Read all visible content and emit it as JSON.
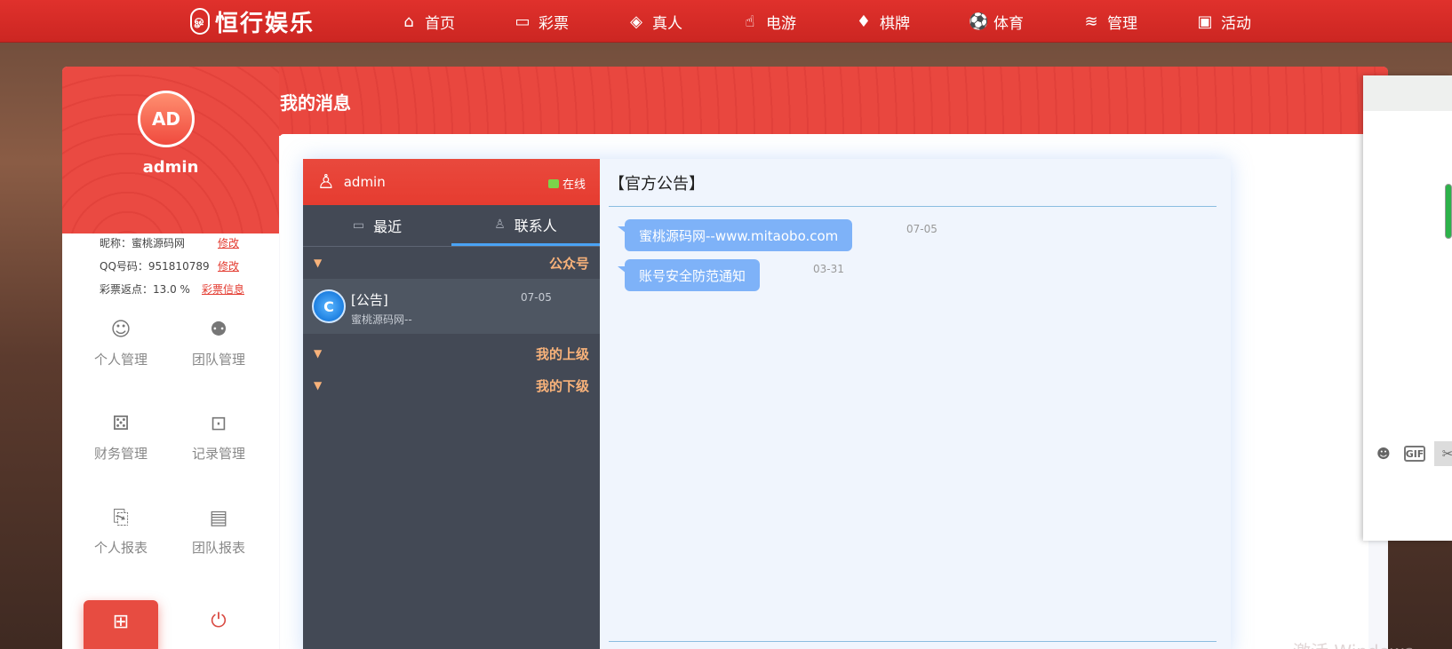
{
  "topnav": {
    "logo_text": "恒行娱乐",
    "logo_mark": "ம",
    "items": [
      {
        "label": "首页",
        "icon": "home-icon"
      },
      {
        "label": "彩票",
        "icon": "ticket-icon"
      },
      {
        "label": "真人",
        "icon": "casino-icon"
      },
      {
        "label": "电游",
        "icon": "thumb-icon"
      },
      {
        "label": "棋牌",
        "icon": "cards-icon"
      },
      {
        "label": "体育",
        "icon": "ball-icon"
      },
      {
        "label": "管理",
        "icon": "layers-icon"
      },
      {
        "label": "活动",
        "icon": "gift-icon"
      }
    ]
  },
  "sidebar": {
    "avatar_text": "AD",
    "username": "admin",
    "nickname_label": "昵称：蜜桃源码网",
    "nickname_edit": "修改",
    "qq_label": "QQ号码：951810789",
    "qq_edit": "修改",
    "rebate_label": "彩票返点：13.0 %",
    "rebate_link": "彩票信息",
    "menu": [
      {
        "label": "个人管理",
        "icon": "user-gear-icon"
      },
      {
        "label": "团队管理",
        "icon": "team-icon"
      },
      {
        "label": "财务管理",
        "icon": "dice-icon"
      },
      {
        "label": "记录管理",
        "icon": "record-icon"
      },
      {
        "label": "个人报表",
        "icon": "report-icon"
      },
      {
        "label": "团队报表",
        "icon": "monitor-chart-icon"
      },
      {
        "label": "",
        "icon": "grid-icon"
      },
      {
        "label": "",
        "icon": "power-icon"
      }
    ]
  },
  "page": {
    "title": "我的消息"
  },
  "chat": {
    "header_user": "admin",
    "status": "在线",
    "tabs": [
      {
        "label": "最近",
        "icon": "chat-icon"
      },
      {
        "label": "联系人",
        "icon": "contact-icon"
      }
    ],
    "groups": [
      {
        "label": "公众号"
      },
      {
        "label": "我的上级"
      },
      {
        "label": "我的下级"
      }
    ],
    "contact": {
      "name": "[公告]",
      "preview": "蜜桃源码网--",
      "date": "07-05",
      "avatar": "C"
    },
    "main_title": "【官方公告】",
    "messages": [
      {
        "text": "蜜桃源码网--www.mitaobo.com",
        "date": "07-05"
      },
      {
        "text": "账号安全防范通知",
        "date": "03-31"
      }
    ]
  },
  "popup": {
    "tools": [
      "smile-icon",
      "gif-icon",
      "scissors-icon"
    ],
    "gif_text": "GIF"
  },
  "bottom_text": "激活 Windows"
}
